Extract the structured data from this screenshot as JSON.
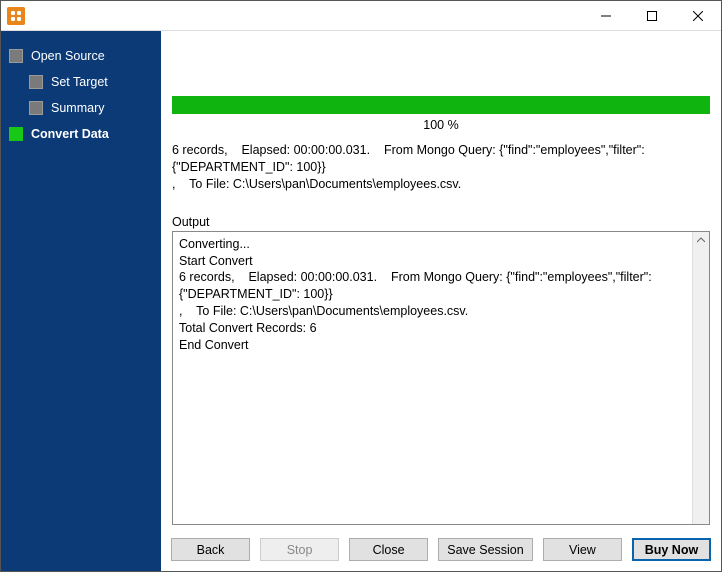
{
  "titlebar": {
    "app_icon": "app-icon"
  },
  "sidebar": {
    "items": [
      {
        "label": "Open Source"
      },
      {
        "label": "Set Target"
      },
      {
        "label": "Summary"
      },
      {
        "label": "Convert Data"
      }
    ]
  },
  "progress": {
    "percent_label": "100 %"
  },
  "summary": "6 records,    Elapsed: 00:00:00.031.    From Mongo Query: {\"find\":\"employees\",\"filter\":{\"DEPARTMENT_ID\": 100}}\n,    To File: C:\\Users\\pan\\Documents\\employees.csv.",
  "output": {
    "label": "Output",
    "text": "Converting...\nStart Convert\n6 records,    Elapsed: 00:00:00.031.    From Mongo Query: {\"find\":\"employees\",\"filter\":{\"DEPARTMENT_ID\": 100}}\n,    To File: C:\\Users\\pan\\Documents\\employees.csv.\nTotal Convert Records: 6\nEnd Convert"
  },
  "buttons": {
    "back": "Back",
    "stop": "Stop",
    "close": "Close",
    "save_session": "Save Session",
    "view": "View",
    "buy_now": "Buy Now"
  },
  "colors": {
    "sidebar_bg": "#0b3a77",
    "progress_green": "#0fb40f",
    "active_step_green": "#17c916",
    "app_icon_orange": "#e8861c",
    "primary_border": "#0a64ad"
  }
}
